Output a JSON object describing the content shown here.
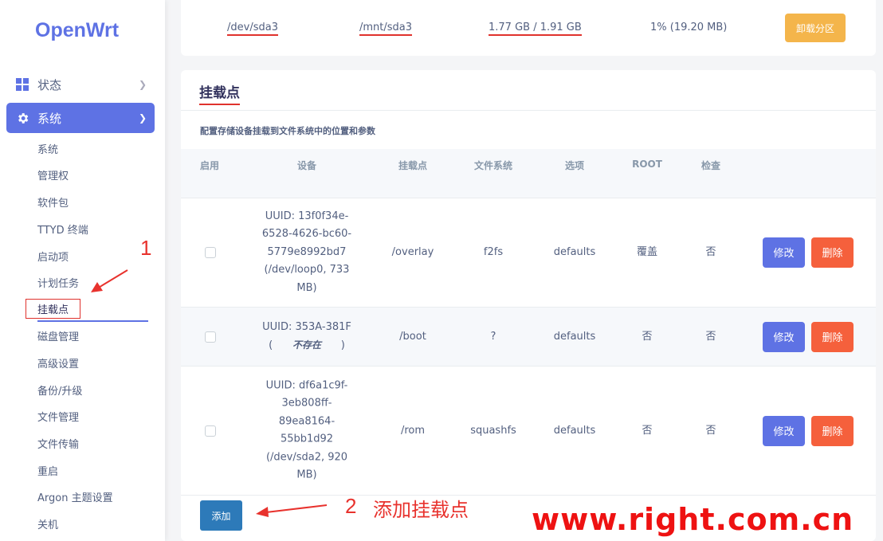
{
  "brand": "OpenWrt",
  "nav": {
    "status_label": "状态",
    "system_label": "系统",
    "sub_items": [
      "系统",
      "管理权",
      "软件包",
      "TTYD 终端",
      "启动项",
      "计划任务",
      "挂载点",
      "磁盘管理",
      "高级设置",
      "备份/升级",
      "文件管理",
      "文件传输",
      "重启",
      "Argon 主题设置",
      "关机"
    ],
    "active_index": 6
  },
  "partition": {
    "device": "/dev/sda3",
    "mount_point": "/mnt/sda3",
    "size": "1.77 GB / 1.91 GB",
    "usage": "1% (19.20 MB)",
    "unmount_label": "卸载分区"
  },
  "mounts": {
    "title": "挂载点",
    "description": "配置存储设备挂载到文件系统中的位置和参数",
    "headers": [
      "启用",
      "设备",
      "挂载点",
      "文件系统",
      "选项",
      "ROOT",
      "检查"
    ],
    "rows": [
      {
        "device_lines": [
          "UUID: 13f0f34e-",
          "6528-4626-bc60-",
          "5779e8992bd7",
          "(/dev/loop0, 733",
          "MB)"
        ],
        "mountpoint": "/overlay",
        "fs": "f2fs",
        "options": "defaults",
        "root": "覆盖",
        "check": "否",
        "enabled": false
      },
      {
        "device_lines": [
          "UUID: 353A-381F"
        ],
        "device_note": "不存在",
        "mountpoint": "/boot",
        "fs": "?",
        "options": "defaults",
        "root": "否",
        "check": "否",
        "enabled": false
      },
      {
        "device_lines": [
          "UUID: df6a1c9f-",
          "3eb808ff-",
          "89ea8164-",
          "55bb1d92",
          "(/dev/sda2, 920",
          "MB)"
        ],
        "mountpoint": "/rom",
        "fs": "squashfs",
        "options": "defaults",
        "root": "否",
        "check": "否",
        "enabled": false
      }
    ],
    "edit_label": "修改",
    "delete_label": "删除",
    "add_label": "添加"
  },
  "annotations": {
    "one": "1",
    "two": "2",
    "two_text": "添加挂载点",
    "watermark": "www.right.com.cn"
  },
  "colors": {
    "accent": "#5e72e4",
    "warning": "#f4b54b",
    "danger": "#f5603c",
    "annotation": "#e8322d"
  }
}
